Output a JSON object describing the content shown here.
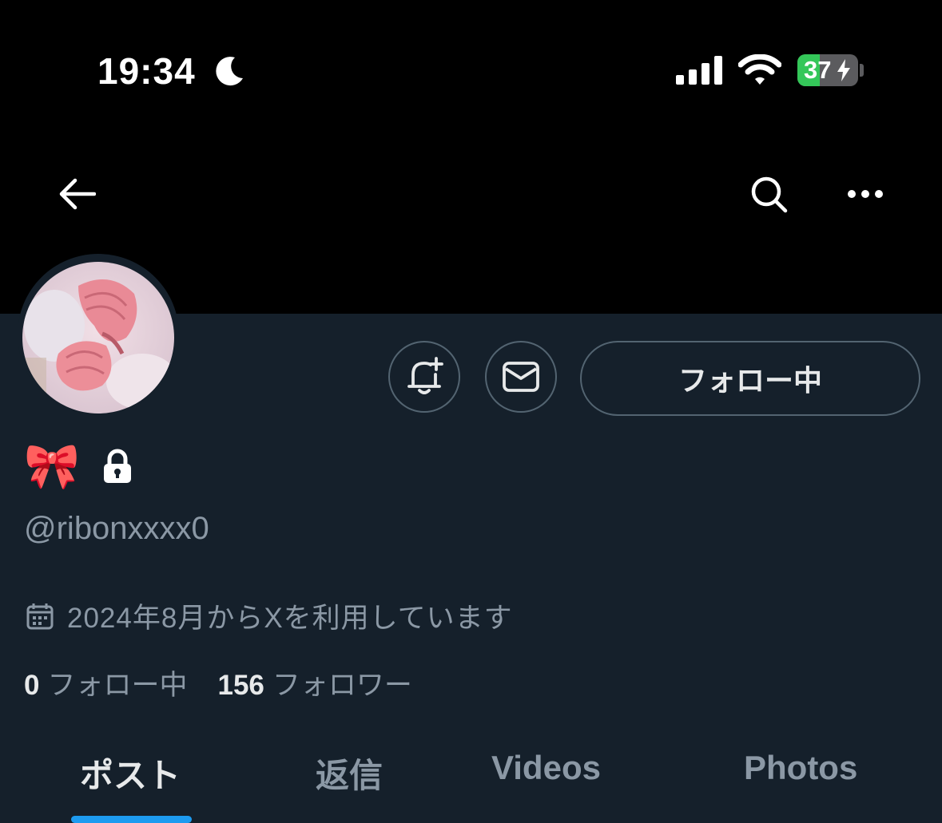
{
  "status_bar": {
    "time": "19:34",
    "battery_level": "37",
    "icons": [
      "moon-icon",
      "signal-icon",
      "wifi-icon",
      "battery-icon"
    ]
  },
  "nav": {
    "icons": [
      "back-arrow-icon",
      "search-icon",
      "more-icon"
    ]
  },
  "profile": {
    "display_name_emoji": "🎀",
    "handle": "@ribonxxxx0",
    "joined": "2024年8月からXを利用しています",
    "follow_button": "フォロー中",
    "following_count": "0",
    "following_label": "フォロー中",
    "followers_count": "156",
    "followers_label": "フォロワー"
  },
  "tabs": [
    {
      "label": "ポスト",
      "active": true
    },
    {
      "label": "返信",
      "active": false
    },
    {
      "label": "Videos",
      "active": false
    },
    {
      "label": "Photos",
      "active": false
    }
  ],
  "colors": {
    "background": "#15202b",
    "header": "#000000",
    "accent": "#1d9bf0",
    "muted_text": "#8b98a5",
    "battery_green": "#34c759"
  }
}
